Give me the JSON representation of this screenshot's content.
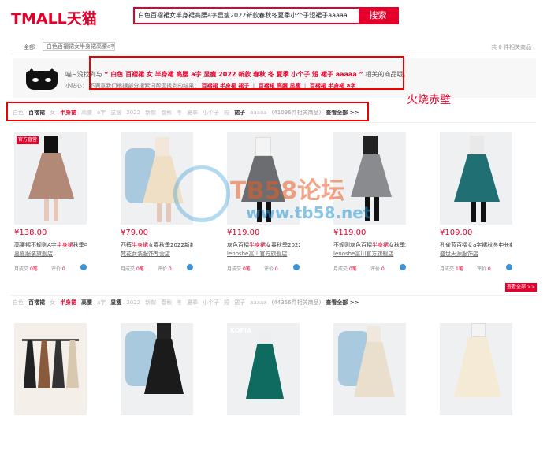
{
  "header": {
    "logo": "TMALL天猫",
    "search_value": "白色百褶裙女半身裙高腰a字显瘦2022新款春秋冬夏季小个子短裙子aaaaa",
    "search_button": "搜索"
  },
  "crumb": {
    "all": "全部",
    "box": "白色百褶裙女半身裙高腰a字",
    "pager": "共 0 件相关商品"
  },
  "tip": {
    "line1_prefix": "喵~没找到与",
    "line1_query": "“ 白色 百褶裙 女 半身裙 高腰 a字 显瘦 2022 新款 春秋 冬 夏季 小个子 短 裙子 aaaaa ”",
    "line1_suffix": "相关的商品哦。",
    "line2_prefix": "小贴心：",
    "line2_text": "不满意我们根据部分搜索词帮您找到的结果：",
    "r1": "百褶裙 半身裙 裙子",
    "r2": "百褶裙 高腰 显瘦",
    "r3": "百褶裙 半身裙 a字"
  },
  "annotation": "火烧赤壁",
  "watermark": {
    "line1": "TB58论坛",
    "line2": "www.tb58.net"
  },
  "row1": {
    "kws": [
      {
        "t": "白色",
        "c": ""
      },
      {
        "t": "百褶裙",
        "c": "h"
      },
      {
        "t": "女",
        "c": ""
      },
      {
        "t": "半身裙",
        "c": "r"
      },
      {
        "t": "高腰",
        "c": ""
      },
      {
        "t": "a字",
        "c": ""
      },
      {
        "t": "显瘦",
        "c": ""
      },
      {
        "t": "2022",
        "c": ""
      },
      {
        "t": "新款",
        "c": ""
      },
      {
        "t": "春秋",
        "c": ""
      },
      {
        "t": "冬",
        "c": ""
      },
      {
        "t": "夏季",
        "c": ""
      },
      {
        "t": "小个子",
        "c": ""
      },
      {
        "t": "短",
        "c": ""
      },
      {
        "t": "裙子",
        "c": "h"
      },
      {
        "t": "aaaaa",
        "c": ""
      },
      {
        "t": "(41096件相关商品)",
        "c": "g"
      },
      {
        "t": "查看全部 >>",
        "c": "h"
      }
    ]
  },
  "products1": [
    {
      "price": "¥138.00",
      "t1": "高腰褶不规则A字",
      "hl": "半身裙",
      "t2": "秋季中长款",
      "shop": "嘉嘉服装旗舰店",
      "sales_label": "月成交",
      "sales": "0笔",
      "rev_label": "评价",
      "rev": "0",
      "badge": "官方直营"
    },
    {
      "price": "¥79.00",
      "t1": "西裤",
      "hl": "半身裙",
      "t2": "女春秋季2022新款百褶",
      "shop": "梵花女装服饰专营店",
      "sales_label": "月成交",
      "sales": "0笔",
      "rev_label": "评价",
      "rev": "0"
    },
    {
      "price": "¥119.00",
      "t1": "灰色百褶",
      "hl": "半身裙",
      "t2": "女春秋季2022新款半",
      "shop": "lenoshe富川官方旗舰店",
      "sales_label": "月成交",
      "sales": "0笔",
      "rev_label": "评价",
      "rev": "0"
    },
    {
      "price": "¥119.00",
      "t1": "不规则灰色百褶",
      "hl": "半身裙",
      "t2": "女秋季2022新款",
      "shop": "lenoshe富川官方旗舰店",
      "sales_label": "月成交",
      "sales": "0笔",
      "rev_label": "评价",
      "rev": "0"
    },
    {
      "price": "¥109.00",
      "t1": "孔雀蓝百褶",
      "hl": "",
      "t2": "女a字裙秋冬中长款2022新款",
      "shop": "盛世天源服饰店",
      "sales_label": "月成交",
      "sales": "1笔",
      "rev_label": "评价",
      "rev": "0"
    }
  ],
  "more_button": "查看全部 >>",
  "row2": {
    "kws": [
      {
        "t": "白色",
        "c": ""
      },
      {
        "t": "百褶裙",
        "c": "h"
      },
      {
        "t": "女",
        "c": ""
      },
      {
        "t": "半身裙",
        "c": "r"
      },
      {
        "t": "高腰",
        "c": "h"
      },
      {
        "t": "a字",
        "c": ""
      },
      {
        "t": "显瘦",
        "c": "h"
      },
      {
        "t": "2022",
        "c": ""
      },
      {
        "t": "新款",
        "c": ""
      },
      {
        "t": "春秋",
        "c": ""
      },
      {
        "t": "冬",
        "c": ""
      },
      {
        "t": "夏季",
        "c": ""
      },
      {
        "t": "小个子",
        "c": ""
      },
      {
        "t": "短",
        "c": ""
      },
      {
        "t": "裙子",
        "c": ""
      },
      {
        "t": "aaaaa",
        "c": ""
      },
      {
        "t": "(44356件相关商品)",
        "c": "g"
      },
      {
        "t": "查看全部 >>",
        "c": "h"
      }
    ]
  },
  "products2_label": "KOFIA"
}
